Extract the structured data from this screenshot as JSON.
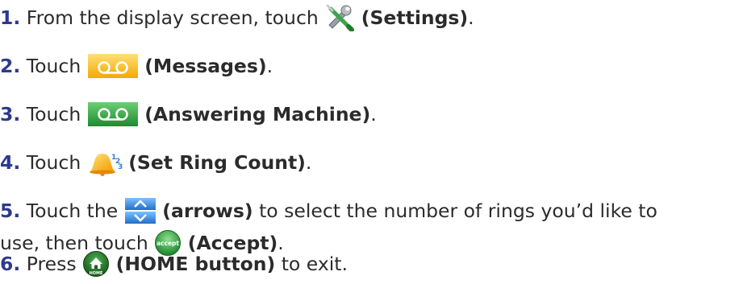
{
  "steps": [
    {
      "number": "1.",
      "before": "From the display screen, touch",
      "icon": "settings-icon",
      "action": "(Settings)",
      "after": "."
    },
    {
      "number": "2.",
      "before": "Touch",
      "icon": "messages-icon",
      "action": "(Messages)",
      "after": "."
    },
    {
      "number": "3.",
      "before": "Touch",
      "icon": "answering-machine-icon",
      "action": "(Answering Machine)",
      "after": "."
    },
    {
      "number": "4.",
      "before": "Touch",
      "icon": "bell-icon",
      "action": "(Set Ring Count)",
      "after": "."
    },
    {
      "number": "5.",
      "before": "Touch the",
      "icon": "arrows-icon",
      "action": "(arrows)",
      "after": "to select the number of rings you’d like to",
      "line2_before": "use, then touch",
      "icon2": "accept-icon",
      "icon2_label": "accept",
      "action2": "(Accept)",
      "after2": "."
    },
    {
      "number": "6.",
      "before": "Press",
      "icon": "home-button-icon",
      "icon_label": "HOME",
      "action": "(HOME button)",
      "after": "to exit."
    }
  ],
  "colors": {
    "step_number": "#2c3a8c",
    "text": "#2b2b2b",
    "messages_button": "#f5b800",
    "answering_machine_button": "#2a9a3a",
    "arrows_button": "#2f7fd6",
    "accept_button": "#3aa54a",
    "home_button": "#2e7d32",
    "bell": "#f6b51c"
  }
}
